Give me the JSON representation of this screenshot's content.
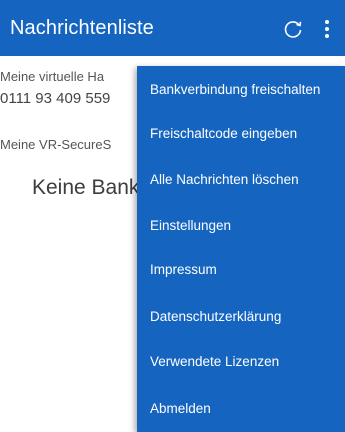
{
  "appbar": {
    "title": "Nachrichtenliste",
    "color": "#1565c0",
    "icons": [
      "refresh-icon",
      "more-vert-icon"
    ]
  },
  "content": {
    "account_label": "Meine virtuelle Ha",
    "account_number": "0111 93 409 559",
    "secure_label": "Meine VR-SecureS",
    "empty_text": "Keine Bank"
  },
  "menu": {
    "items": [
      "Bankverbindung freischalten",
      "Freischaltcode eingeben",
      "Alle Nachrichten löschen",
      "Einstellungen",
      "Impressum",
      "Datenschutzerklärung",
      "Verwendete Lizenzen",
      "Abmelden"
    ]
  }
}
